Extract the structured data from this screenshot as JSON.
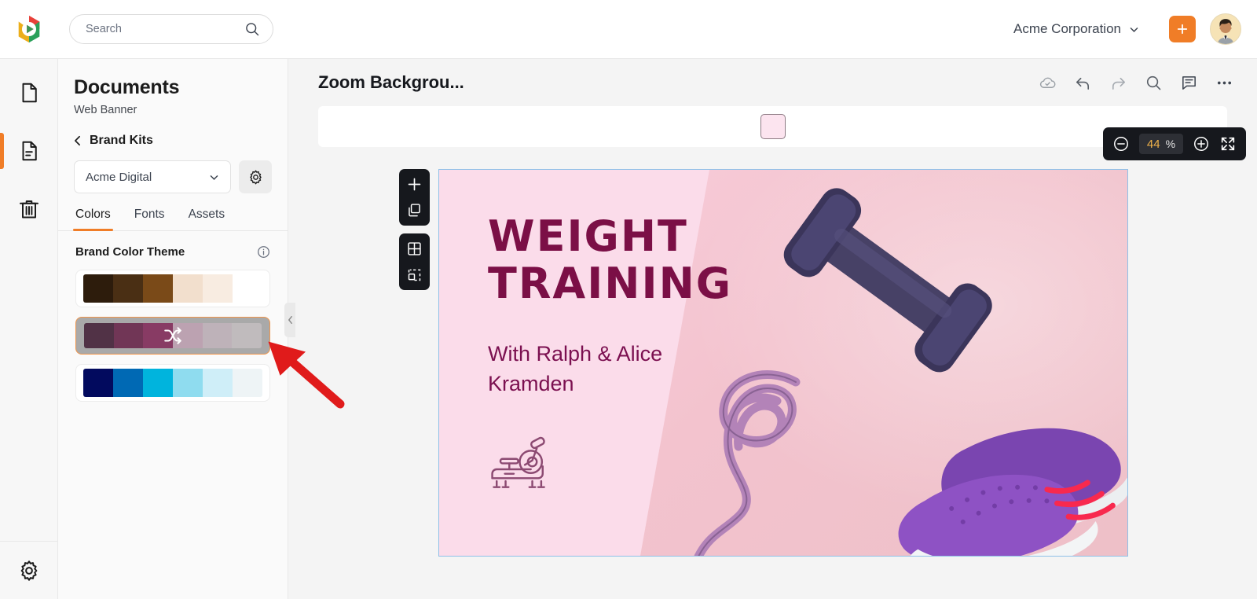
{
  "app": {
    "logo_name": "app-logo"
  },
  "topbar": {
    "search_placeholder": "Search",
    "search_value": "",
    "org_name": "Acme Corporation",
    "create_button_label": "+",
    "icons": {
      "search": "search-icon",
      "chevron": "chevron-down-icon",
      "avatar": "user-avatar"
    }
  },
  "rail": {
    "items": [
      {
        "name": "new-document",
        "label": "New Document",
        "active": false
      },
      {
        "name": "documents",
        "label": "Documents",
        "active": true
      },
      {
        "name": "trash",
        "label": "Trash",
        "active": false
      }
    ],
    "settings_label": "Settings"
  },
  "panel": {
    "title": "Documents",
    "subtitle": "Web Banner",
    "back_label": "Brand Kits",
    "kit_selected": "Acme Digital",
    "settings_icon": "gear-icon",
    "tabs": [
      {
        "label": "Colors",
        "active": true
      },
      {
        "label": "Fonts",
        "active": false
      },
      {
        "label": "Assets",
        "active": false
      }
    ],
    "section_title": "Brand Color Theme",
    "info_icon": "info-icon",
    "themes": [
      {
        "name": "brown-theme",
        "selected": false,
        "colors": [
          "#2d1c0c",
          "#4a2f14",
          "#7a4a18",
          "#f2dfcd",
          "#f8ece1",
          "#ffffff"
        ]
      },
      {
        "name": "maroon-theme",
        "selected": true,
        "shuffle_icon": "shuffle-icon",
        "colors": [
          "#2f0420",
          "#5c0a36",
          "#7c114a",
          "#c4a0b4",
          "#c6b6bf",
          "#c9c2c5"
        ]
      },
      {
        "name": "blue-theme",
        "selected": false,
        "colors": [
          "#020a5e",
          "#0069b4",
          "#00b4dd",
          "#8fdcef",
          "#cfeef8",
          "#eef4f6"
        ]
      }
    ],
    "collapse_icon": "chevron-left-icon"
  },
  "editor": {
    "doc_title": "Zoom Backgrou...",
    "tools": [
      {
        "name": "cloud-saved-icon",
        "label": "Saved"
      },
      {
        "name": "undo-icon",
        "label": "Undo"
      },
      {
        "name": "redo-icon",
        "label": "Redo"
      },
      {
        "name": "search-icon",
        "label": "Find"
      },
      {
        "name": "comment-icon",
        "label": "Comments"
      },
      {
        "name": "more-options-icon",
        "label": "More"
      }
    ],
    "format_bar": {
      "fill_color": "#fce4ef",
      "fill_label": "Fill color"
    },
    "float_tools": [
      {
        "name": "add-page-icon",
        "label": "Add"
      },
      {
        "name": "duplicate-page-icon",
        "label": "Duplicate"
      },
      {
        "name": "grid-layout-icon",
        "label": "Layouts"
      },
      {
        "name": "select-frame-icon",
        "label": "Select frame"
      }
    ],
    "zoom": {
      "value": "44",
      "unit": "%",
      "out_icon": "zoom-out-icon",
      "in_icon": "zoom-in-icon",
      "fit_icon": "fullscreen-icon"
    }
  },
  "artboard": {
    "title_line1": "WEIGHT",
    "title_line2": "TRAINING",
    "subtitle": "With Ralph & Alice Kramden",
    "icon_name": "exercise-bike-icon",
    "title_color": "#7b0f46",
    "bg_color": "#fbdcea",
    "photo_objects": [
      "dumbbell",
      "resistance-band",
      "sneakers"
    ]
  },
  "annotation": {
    "name": "red-pointer-arrow",
    "color": "#e01b1b"
  }
}
